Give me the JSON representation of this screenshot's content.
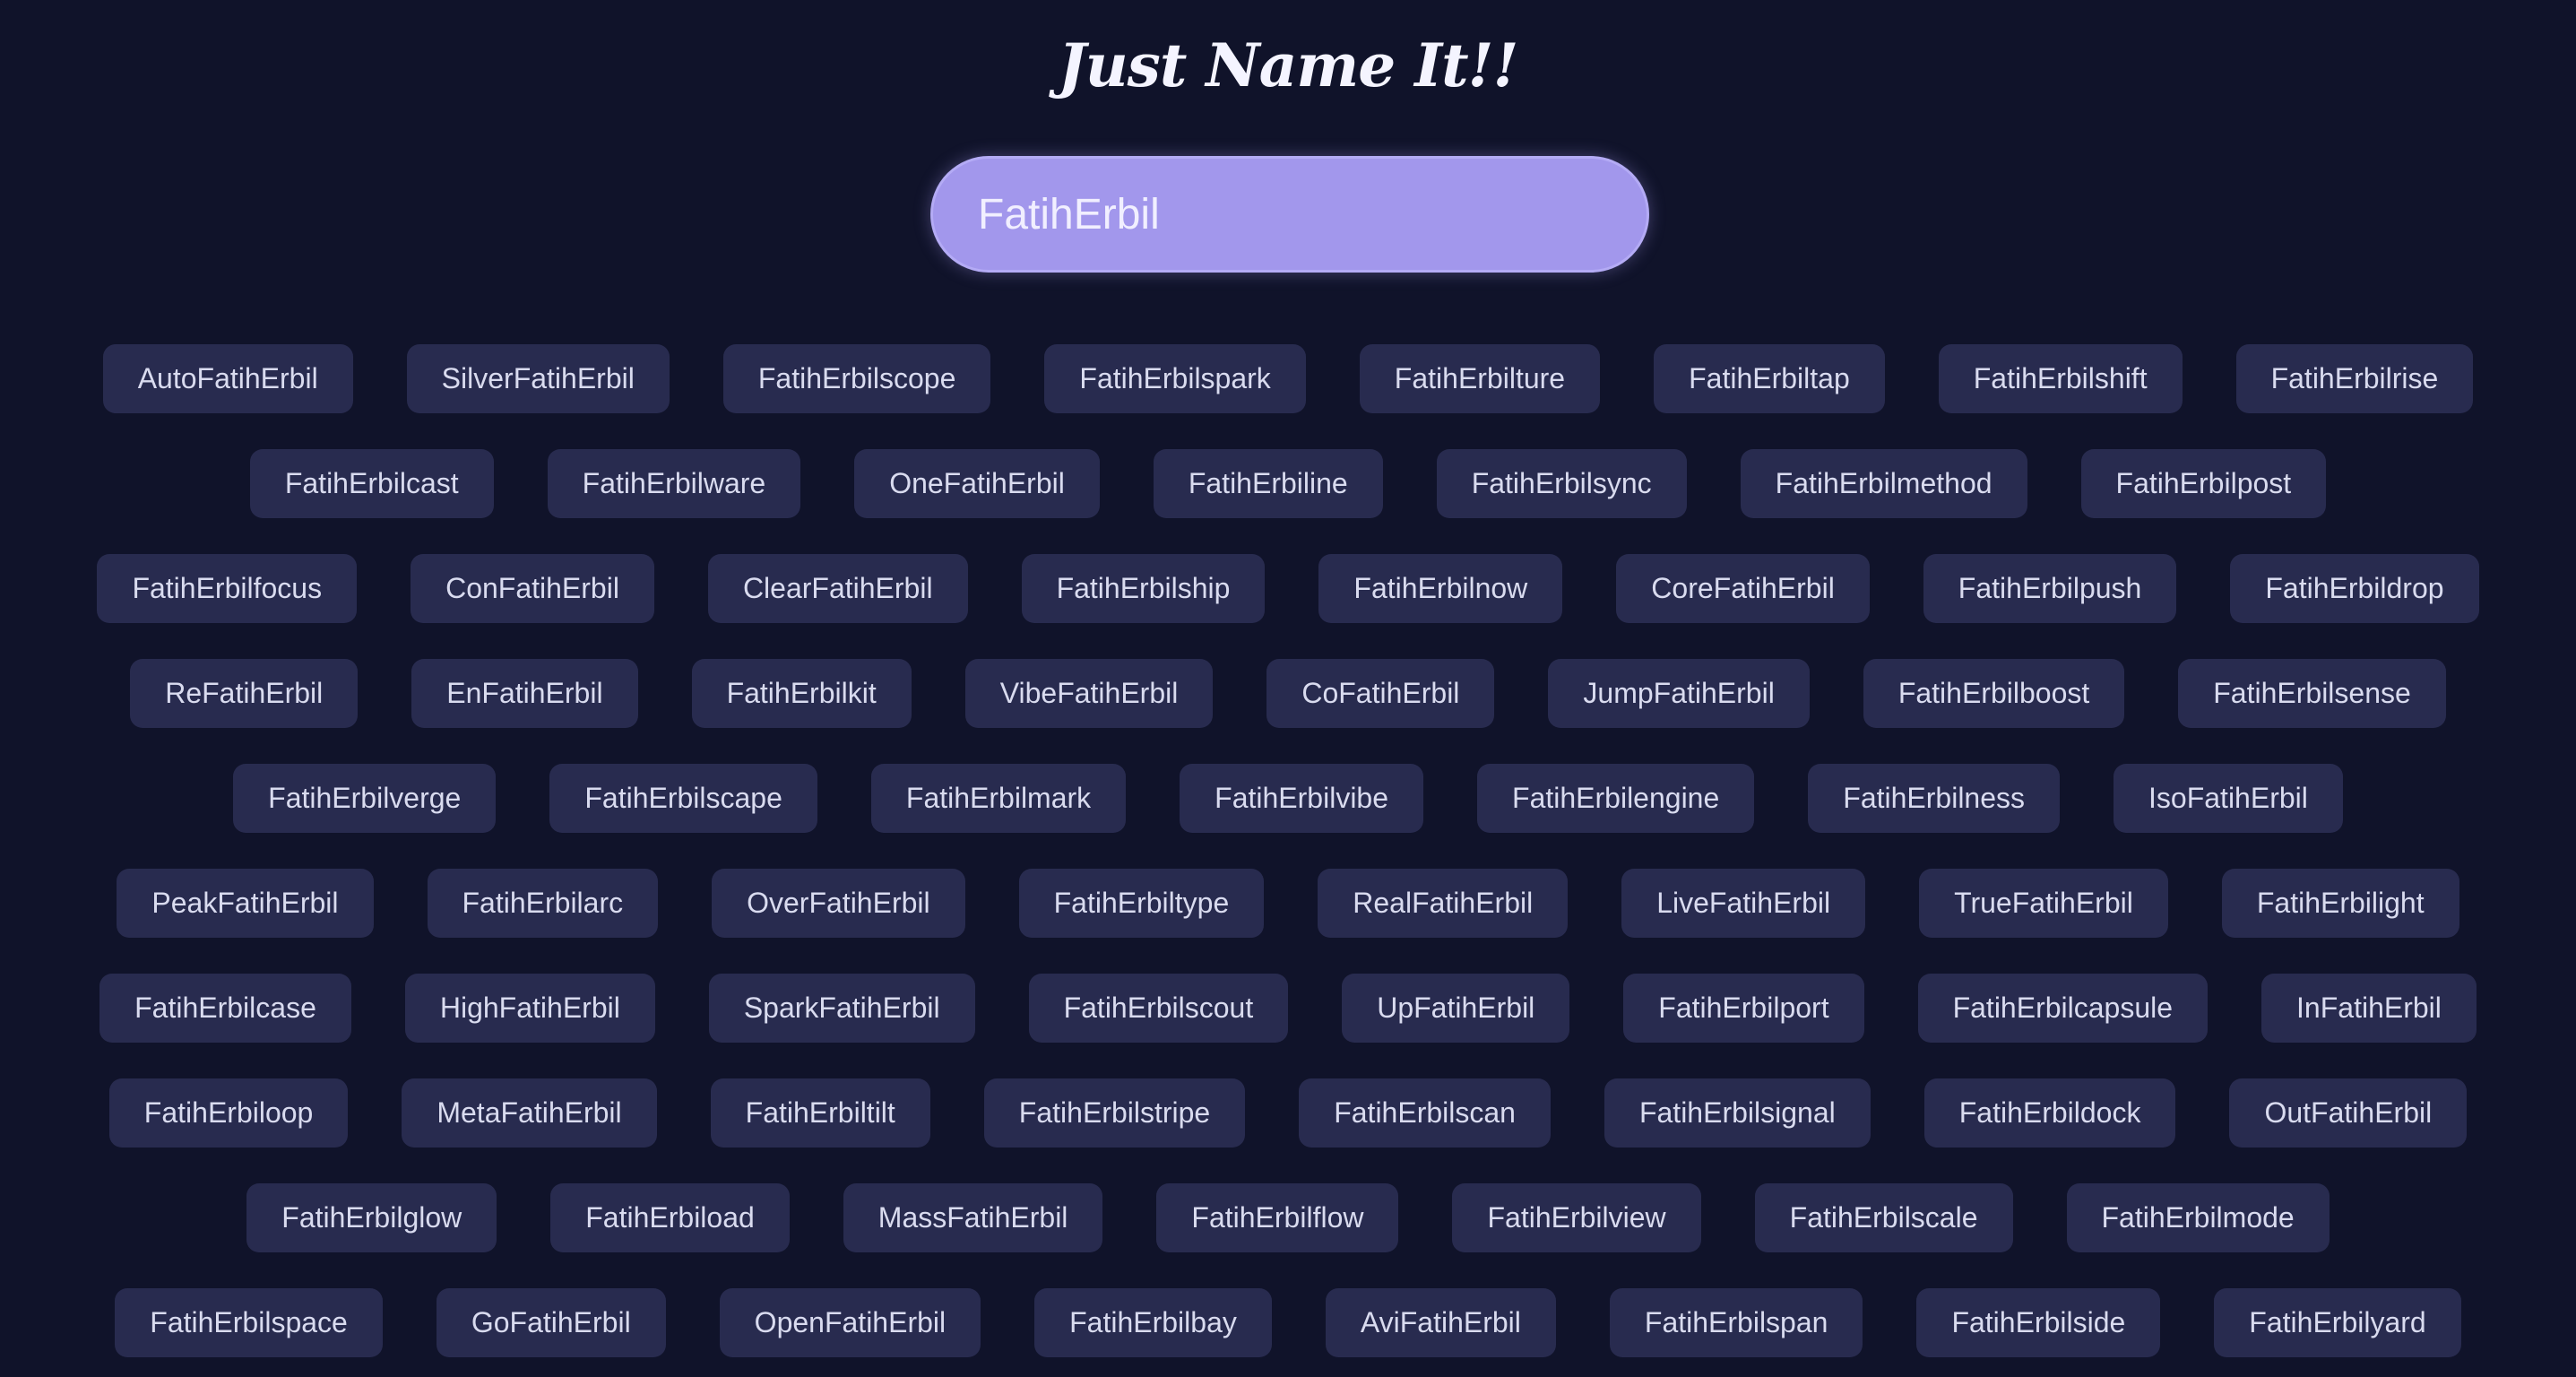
{
  "title": "Just Name It!!",
  "search": {
    "value": "FatihErbil",
    "placeholder": ""
  },
  "colors": {
    "background": "#10132a",
    "chip_background": "#282b4f",
    "search_background": "#a297ec"
  },
  "suggestion_rows": [
    [
      "AutoFatihErbil",
      "SilverFatihErbil",
      "FatihErbilscope",
      "FatihErbilspark",
      "FatihErbilture",
      "FatihErbiltap",
      "FatihErbilshift",
      "FatihErbilrise"
    ],
    [
      "FatihErbilcast",
      "FatihErbilware",
      "OneFatihErbil",
      "FatihErbiline",
      "FatihErbilsync",
      "FatihErbilmethod",
      "FatihErbilpost"
    ],
    [
      "FatihErbilfocus",
      "ConFatihErbil",
      "ClearFatihErbil",
      "FatihErbilship",
      "FatihErbilnow",
      "CoreFatihErbil",
      "FatihErbilpush",
      "FatihErbildrop"
    ],
    [
      "ReFatihErbil",
      "EnFatihErbil",
      "FatihErbilkit",
      "VibeFatihErbil",
      "CoFatihErbil",
      "JumpFatihErbil",
      "FatihErbilboost",
      "FatihErbilsense"
    ],
    [
      "FatihErbilverge",
      "FatihErbilscape",
      "FatihErbilmark",
      "FatihErbilvibe",
      "FatihErbilengine",
      "FatihErbilness",
      "IsoFatihErbil"
    ],
    [
      "PeakFatihErbil",
      "FatihErbilarc",
      "OverFatihErbil",
      "FatihErbiltype",
      "RealFatihErbil",
      "LiveFatihErbil",
      "TrueFatihErbil",
      "FatihErbilight"
    ],
    [
      "FatihErbilcase",
      "HighFatihErbil",
      "SparkFatihErbil",
      "FatihErbilscout",
      "UpFatihErbil",
      "FatihErbilport",
      "FatihErbilcapsule",
      "InFatihErbil"
    ],
    [
      "FatihErbiloop",
      "MetaFatihErbil",
      "FatihErbiltilt",
      "FatihErbilstripe",
      "FatihErbilscan",
      "FatihErbilsignal",
      "FatihErbildock",
      "OutFatihErbil"
    ],
    [
      "FatihErbilglow",
      "FatihErbiload",
      "MassFatihErbil",
      "FatihErbilflow",
      "FatihErbilview",
      "FatihErbilscale",
      "FatihErbilmode"
    ],
    [
      "FatihErbilspace",
      "GoFatihErbil",
      "OpenFatihErbil",
      "FatihErbilbay",
      "AviFatihErbil",
      "FatihErbilspan",
      "FatihErbilside",
      "FatihErbilyard"
    ]
  ]
}
